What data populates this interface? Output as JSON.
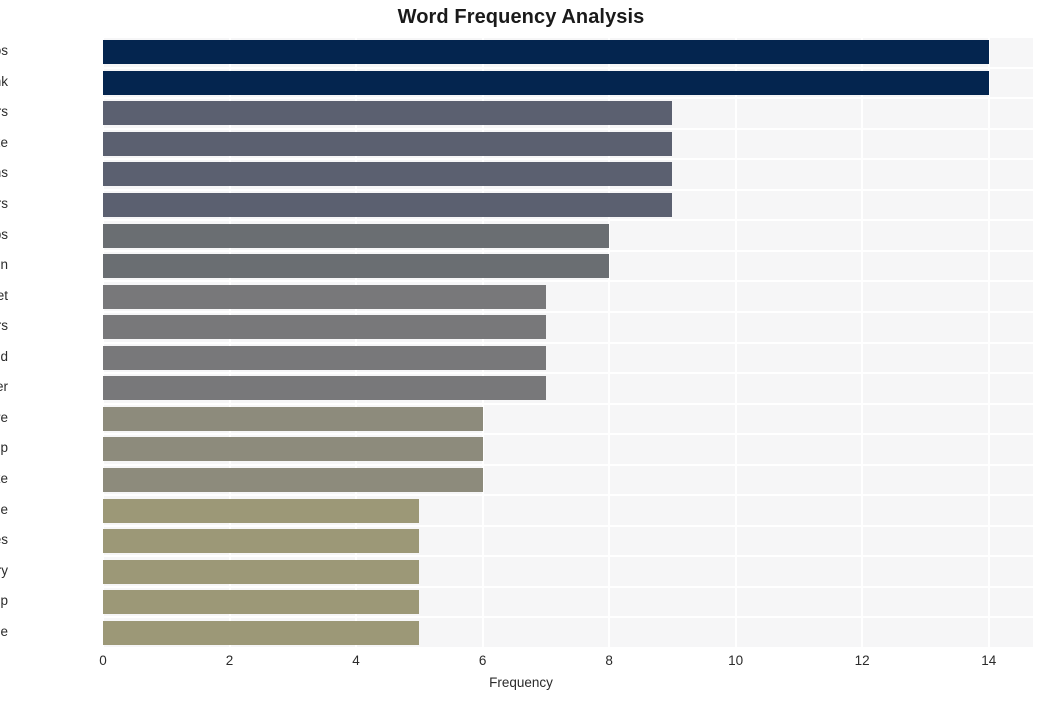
{
  "chart_data": {
    "type": "bar",
    "orientation": "horizontal",
    "title": "Word Frequency Analysis",
    "xlabel": "Frequency",
    "ylabel": "",
    "categories": [
      "ios",
      "bank",
      "users",
      "goldpickaxe",
      "victims",
      "attackers",
      "apps",
      "version",
      "target",
      "researchers",
      "android",
      "golddigger",
      "malware",
      "group",
      "fake",
      "apple",
      "devices",
      "goldfactory",
      "app",
      "include"
    ],
    "values": [
      14,
      14,
      9,
      9,
      9,
      9,
      8,
      8,
      7,
      7,
      7,
      7,
      6,
      6,
      6,
      5,
      5,
      5,
      5,
      5
    ],
    "bar_colors": [
      "#04254f",
      "#04254f",
      "#5b6070",
      "#5b6070",
      "#5b6070",
      "#5b6070",
      "#6a6e72",
      "#6a6e72",
      "#78787a",
      "#78787a",
      "#78787a",
      "#78787a",
      "#8d8b7c",
      "#8d8b7c",
      "#8d8b7c",
      "#9c9877",
      "#9c9877",
      "#9c9877",
      "#9c9877",
      "#9c9877"
    ],
    "xlim": [
      0,
      14.7
    ],
    "xticks": [
      0,
      2,
      4,
      6,
      8,
      10,
      12,
      14
    ],
    "xtick_labels": [
      "0",
      "2",
      "4",
      "6",
      "8",
      "10",
      "12",
      "14"
    ],
    "grid": true,
    "grid_color": "#ffffff",
    "plot_background": "#f6f6f7",
    "figure_background": "#ffffff",
    "legend": null
  }
}
